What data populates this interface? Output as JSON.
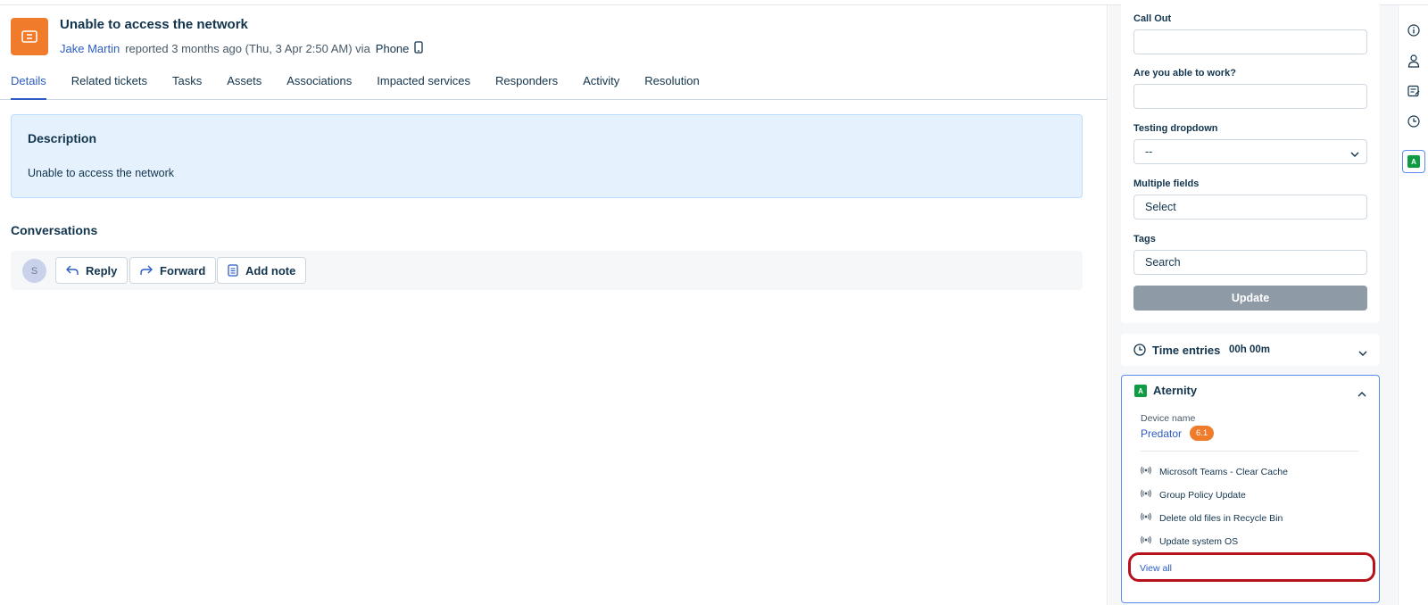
{
  "ticket": {
    "icon": "ticket-icon",
    "title": "Unable to access the network",
    "author": "Jake Martin",
    "reported": "reported 3 months ago (Thu, 3 Apr 2:50 AM) via",
    "source": "Phone",
    "source_icon": "mobile-phone-icon"
  },
  "tabs": [
    {
      "label": "Details",
      "active": true
    },
    {
      "label": "Related tickets"
    },
    {
      "label": "Tasks"
    },
    {
      "label": "Assets"
    },
    {
      "label": "Associations"
    },
    {
      "label": "Impacted services"
    },
    {
      "label": "Responders"
    },
    {
      "label": "Activity"
    },
    {
      "label": "Resolution"
    }
  ],
  "description": {
    "title": "Description",
    "text": "Unable to access the network"
  },
  "conversations": {
    "title": "Conversations",
    "avatar": "S",
    "reply": "Reply",
    "forward": "Forward",
    "add_note": "Add note"
  },
  "properties": {
    "call_out_label": "Call Out",
    "call_out_value": "",
    "able_to_work_label": "Are you able to work?",
    "able_to_work_value": "",
    "testing_dropdown_label": "Testing dropdown",
    "testing_dropdown_value": "--",
    "multiple_fields_label": "Multiple fields",
    "multiple_fields_value": "Select",
    "tags_label": "Tags",
    "tags_placeholder": "Search",
    "update_label": "Update"
  },
  "time_entries": {
    "label": "Time entries",
    "value": "00h 00m"
  },
  "aternity": {
    "badge": "A",
    "title": "Aternity",
    "device_label": "Device name",
    "device_name": "Predator",
    "score": "6.1",
    "actions": [
      "Microsoft Teams - Clear Cache",
      "Group Policy Update",
      "Delete old files in Recycle Bin",
      "Update system OS"
    ],
    "view_all": "View all"
  },
  "sidebar_icons": [
    "info-icon",
    "user-icon",
    "notes-icon",
    "clock-icon",
    "aternity-app-icon"
  ],
  "colors": {
    "accent": "#2c5cc5",
    "ticket_icon": "#f07b2b",
    "aternity_green": "#0d9b44",
    "highlight": "#b5121b"
  }
}
